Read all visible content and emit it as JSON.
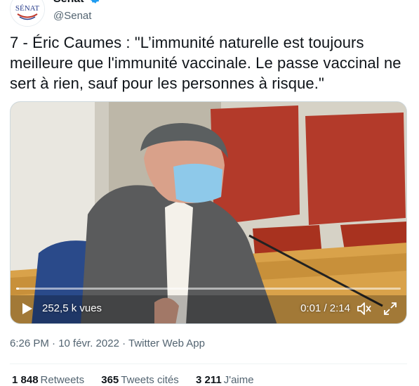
{
  "author": {
    "display_name": "Sénat",
    "handle": "@Senat",
    "avatar_text": "SÉNAT",
    "verified": true
  },
  "tweet": {
    "text": "7 - Éric Caumes : \"L’immunité naturelle est toujours meilleure que l'immunité vaccinale. Le passe vaccinal ne sert à rien, sauf pour les personnes à risque.\"",
    "timestamp": "6:26 PM · 10 févr. 2022",
    "separator": " · ",
    "source": "Twitter Web App"
  },
  "video": {
    "views": "252,5 k vues",
    "time": "0:01 / 2:14",
    "progress": 0.008
  },
  "stats": [
    {
      "count": "1 848",
      "label": "Retweets"
    },
    {
      "count": "365",
      "label": "Tweets cités"
    },
    {
      "count": "3 211",
      "label": "J'aime"
    }
  ],
  "icons": {
    "verified": "verified-badge-icon",
    "play": "play-icon",
    "volume": "volume-icon",
    "fullscreen": "fullscreen-icon"
  },
  "colors": {
    "verified": "#1d9bf0",
    "secondary_text": "#536471",
    "chair_red": "#b33a2a"
  }
}
